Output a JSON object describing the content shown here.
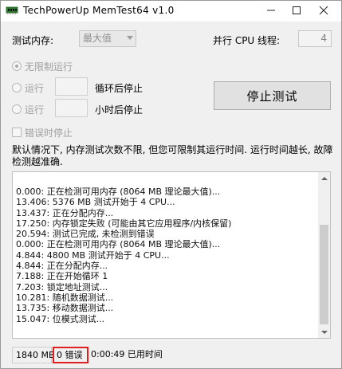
{
  "window": {
    "title": "TechPowerUp MemTest64 v1.0"
  },
  "settings": {
    "memory_label": "测试内存:",
    "memory_select_value": "最大值",
    "threads_label": "并行 CPU 线程:",
    "threads_value": "4",
    "unlimited_label": "无限制运行",
    "run_label_1": "运行",
    "loops_suffix": "循环后停止",
    "run_label_2": "运行",
    "hours_suffix": "小时后停止",
    "stop_on_error_label": "错误时停止"
  },
  "actions": {
    "stop_button_label": "停止测试"
  },
  "description": "默认情况下, 内存测试次数不限, 但您可限制其运行时间. 运行时间越长, 故障检测越准确.",
  "log": [
    "0.000: 正在检测可用内存 (8064 MB 理论最大值)...",
    "13.406: 5376 MB 测试开始于 4 CPU...",
    "13.437: 正在分配内存...",
    "17.250: 内存锁定失败 (可能由其它应用程序/内核保留)",
    "20.594: 测试已完成, 未检测到错误",
    "0.000: 正在检测可用内存 (8064 MB 理论最大值)...",
    "4.844: 4800 MB 测试开始于 4 CPU...",
    "4.844: 正在分配内存...",
    "7.188: 正在开始循环 1",
    "7.203: 锁定地址测试...",
    "10.281: 随机数据测试...",
    "13.735: 移动数据测试...",
    "15.047: 位模式测试..."
  ],
  "status": {
    "memory": "1840 MB",
    "errors": "0 错误",
    "time": "0:00:49 已用时间"
  },
  "colors": {
    "error_highlight": "#e02020",
    "window_bg": "#f0f0f0"
  }
}
